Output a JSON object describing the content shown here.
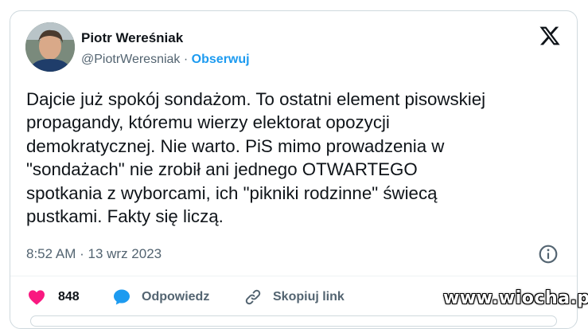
{
  "author": {
    "name": "Piotr Wereśniak",
    "handle": "@PiotrWeresniak",
    "separator": "·",
    "follow_label": "Obserwuj"
  },
  "tweet": {
    "lines": [
      "Dajcie już spokój sondażom. To ostatni element pisowskiej",
      "propagandy, któremu wierzy elektorat opozycji",
      "demokratycznej. Nie warto. PiS mimo prowadzenia w",
      "\"sondażach\" nie zrobił ani jednego OTWARTEGO",
      "spotkania z wyborcami, ich \"pikniki rodzinne\" świecą",
      "pustkami. Fakty się liczą."
    ],
    "time": "8:52 AM",
    "date": "13 wrz 2023",
    "time_separator": "·"
  },
  "actions": {
    "likes_count": "848",
    "reply_label": "Odpowiedz",
    "copy_link_label": "Skopiuj link"
  },
  "icons": [
    "x-logo-icon",
    "info-icon",
    "heart-icon",
    "reply-bubble-icon",
    "link-icon"
  ],
  "colors": {
    "heart": "#f91880",
    "reply": "#1d9bf0",
    "follow": "#1d9bf0",
    "secondary_text": "#536471"
  },
  "watermark": "www.wiocha.pl"
}
